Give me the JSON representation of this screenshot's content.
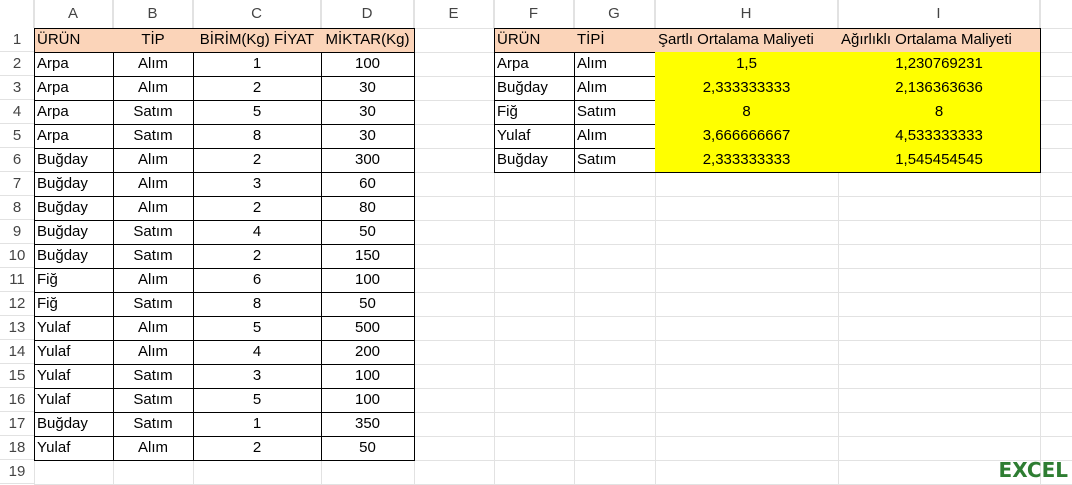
{
  "columns": [
    "A",
    "B",
    "C",
    "D",
    "E",
    "F",
    "G",
    "H",
    "I"
  ],
  "rows": [
    "1",
    "2",
    "3",
    "4",
    "5",
    "6",
    "7",
    "8",
    "9",
    "10",
    "11",
    "12",
    "13",
    "14",
    "15",
    "16",
    "17",
    "18",
    "19"
  ],
  "left_table": {
    "headers": [
      "ÜRÜN",
      "TİP",
      "BİRİM(Kg) FİYAT",
      "MİKTAR(Kg)"
    ],
    "rows": [
      [
        "Arpa",
        "Alım",
        "1",
        "100"
      ],
      [
        "Arpa",
        "Alım",
        "2",
        "30"
      ],
      [
        "Arpa",
        "Satım",
        "5",
        "30"
      ],
      [
        "Arpa",
        "Satım",
        "8",
        "30"
      ],
      [
        "Buğday",
        "Alım",
        "2",
        "300"
      ],
      [
        "Buğday",
        "Alım",
        "3",
        "60"
      ],
      [
        "Buğday",
        "Alım",
        "2",
        "80"
      ],
      [
        "Buğday",
        "Satım",
        "4",
        "50"
      ],
      [
        "Buğday",
        "Satım",
        "2",
        "150"
      ],
      [
        "Fiğ",
        "Alım",
        "6",
        "100"
      ],
      [
        "Fiğ",
        "Satım",
        "8",
        "50"
      ],
      [
        "Yulaf",
        "Alım",
        "5",
        "500"
      ],
      [
        "Yulaf",
        "Alım",
        "4",
        "200"
      ],
      [
        "Yulaf",
        "Satım",
        "3",
        "100"
      ],
      [
        "Yulaf",
        "Satım",
        "5",
        "100"
      ],
      [
        "Buğday",
        "Satım",
        "1",
        "350"
      ],
      [
        "Yulaf",
        "Alım",
        "2",
        "50"
      ]
    ]
  },
  "right_table": {
    "headers": [
      "ÜRÜN",
      "TİPİ",
      "Şartlı Ortalama Maliyeti",
      "Ağırlıklı Ortalama Maliyeti"
    ],
    "rows": [
      [
        "Arpa",
        "Alım",
        "1,5",
        "1,230769231"
      ],
      [
        "Buğday",
        "Alım",
        "2,333333333",
        "2,136363636"
      ],
      [
        "Fiğ",
        "Satım",
        "8",
        "8"
      ],
      [
        "Yulaf",
        "Alım",
        "3,666666667",
        "4,533333333"
      ],
      [
        "Buğday",
        "Satım",
        "2,333333333",
        "1,545454545"
      ]
    ]
  },
  "colors": {
    "header_fill": "#fbd4b9",
    "result_fill": "#ffff00",
    "grid": "#e2e2e2"
  },
  "watermark": "EXCEL"
}
